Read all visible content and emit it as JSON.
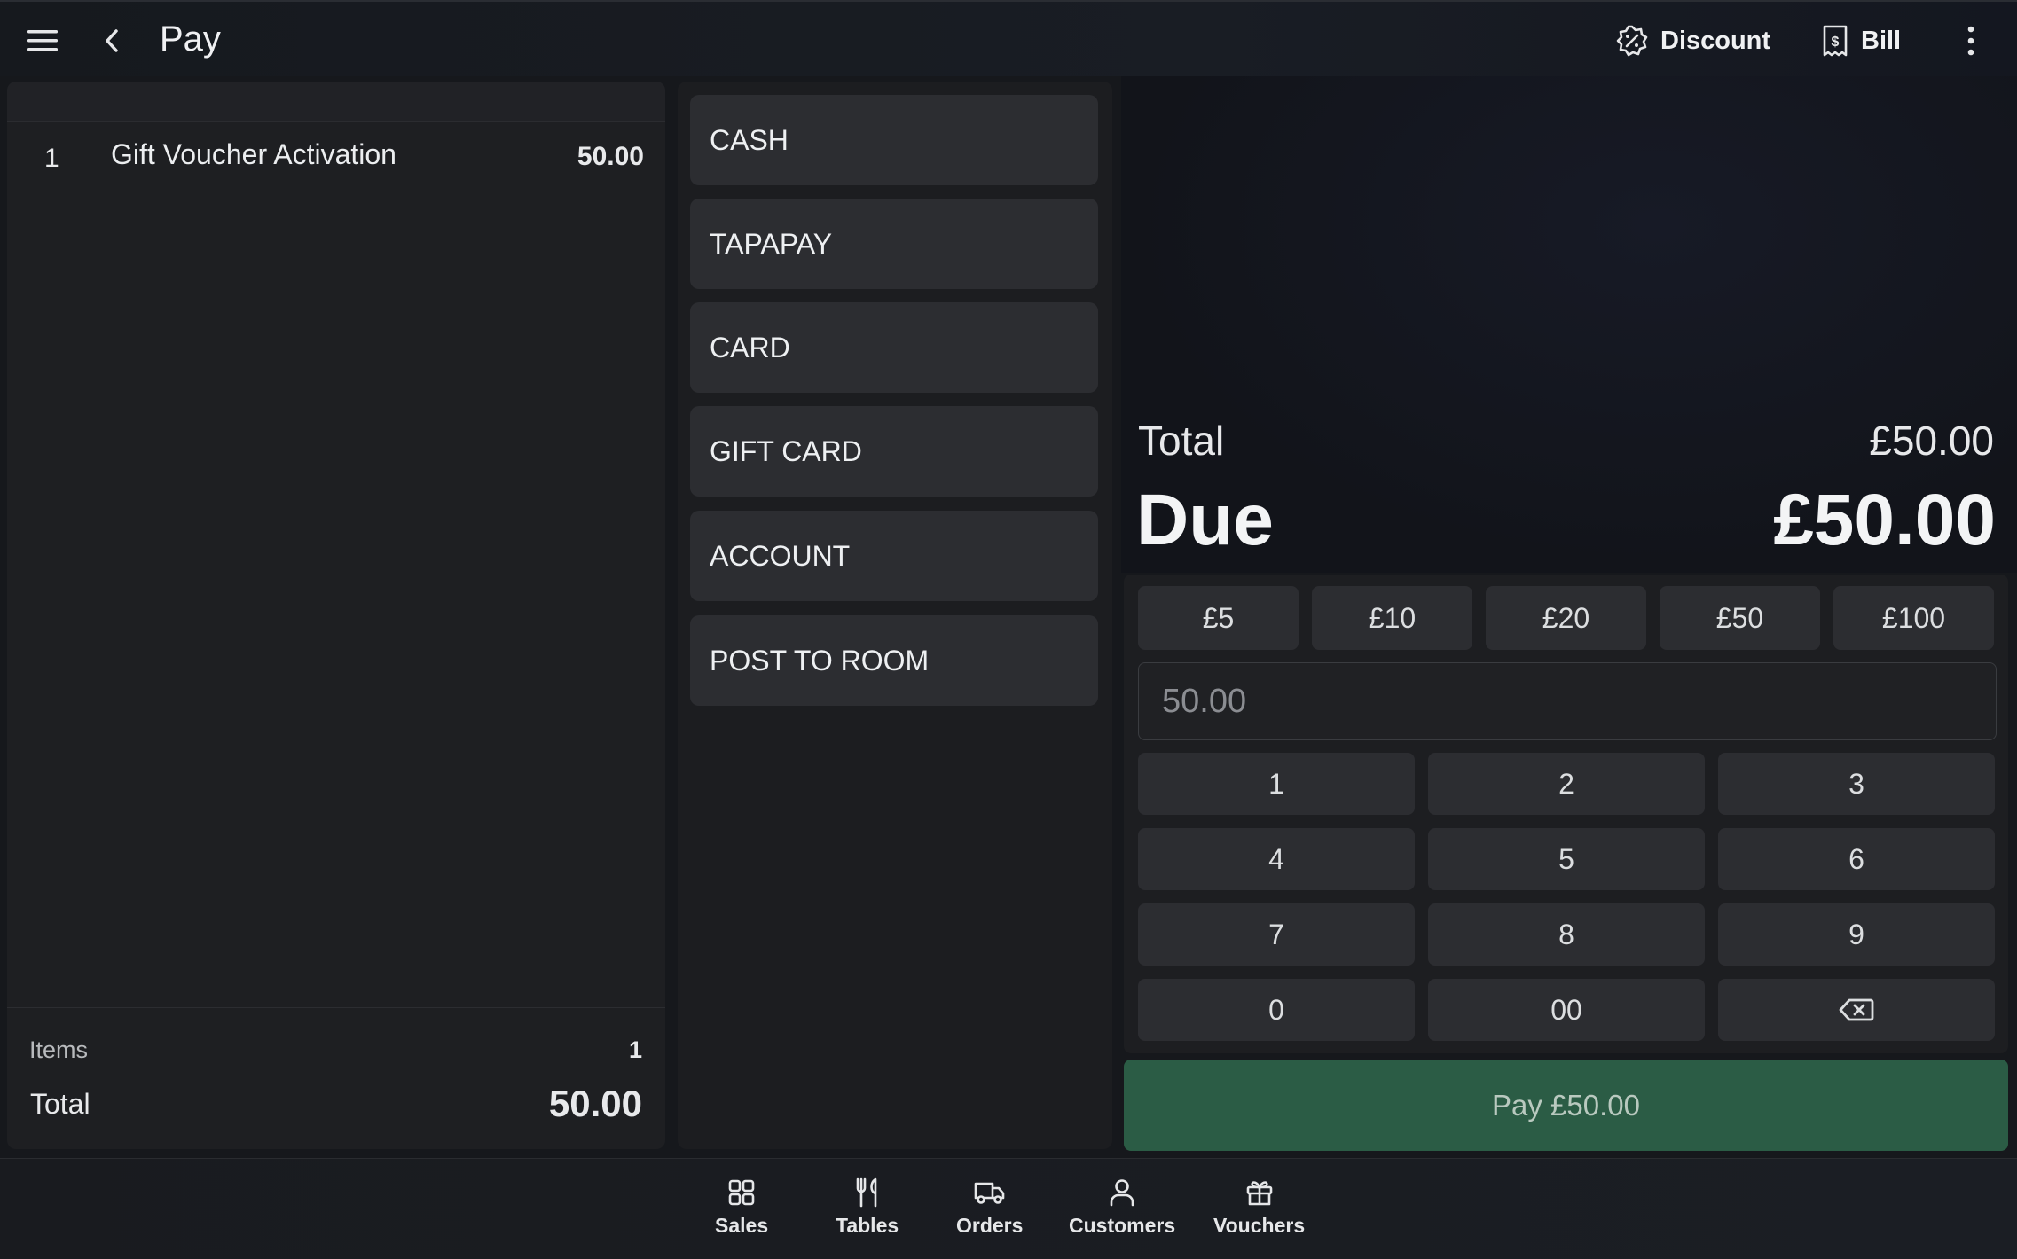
{
  "header": {
    "title": "Pay",
    "discount_label": "Discount",
    "bill_label": "Bill"
  },
  "order": {
    "items": [
      {
        "qty": "1",
        "name": "Gift Voucher Activation",
        "price": "50.00"
      }
    ],
    "items_label": "Items",
    "items_count": "1",
    "total_label": "Total",
    "total_value": "50.00"
  },
  "payment_methods": [
    "CASH",
    "TAPAPAY",
    "CARD",
    "GIFT CARD",
    "ACCOUNT",
    "POST TO ROOM"
  ],
  "summary": {
    "total_label": "Total",
    "total_value": "£50.00",
    "due_label": "Due",
    "due_value": "£50.00"
  },
  "quick_amounts": [
    "£5",
    "£10",
    "£20",
    "£50",
    "£100"
  ],
  "amount_input": {
    "placeholder": "50.00"
  },
  "keypad": [
    "1",
    "2",
    "3",
    "4",
    "5",
    "6",
    "7",
    "8",
    "9",
    "0",
    "00"
  ],
  "pay_button": "Pay £50.00",
  "bottom_nav": [
    {
      "label": "Sales",
      "icon": "grid-icon"
    },
    {
      "label": "Tables",
      "icon": "cutlery-icon"
    },
    {
      "label": "Orders",
      "icon": "delivery-truck-icon"
    },
    {
      "label": "Customers",
      "icon": "person-icon"
    },
    {
      "label": "Vouchers",
      "icon": "gift-icon"
    }
  ],
  "colors": {
    "background": "#16181c",
    "panel": "#1e1f22",
    "button": "#2c2d31",
    "pay_button": "#2b5c45"
  }
}
